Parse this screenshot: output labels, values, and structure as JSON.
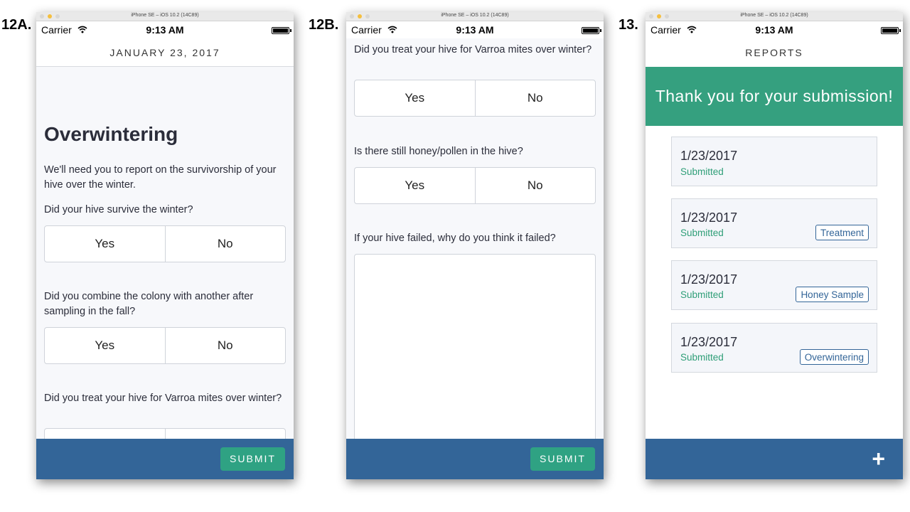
{
  "figure_labels": [
    "12A.",
    "12B.",
    "13."
  ],
  "simulator": {
    "title": "iPhone SE – iOS 10.2 (14C89)"
  },
  "status_bar": {
    "carrier": "Carrier",
    "time": "9:13 AM"
  },
  "screen_a": {
    "nav_title": "JANUARY 23, 2017",
    "heading": "Overwintering",
    "intro": "We'll need you to report on the survivorship of your hive over the winter.",
    "questions": [
      "Did your hive survive the winter?",
      "Did you combine the colony with another after sampling in the fall?",
      "Did you treat your hive for Varroa mites over winter?"
    ],
    "yes_label": "Yes",
    "no_label": "No",
    "submit_label": "SUBMIT"
  },
  "screen_b": {
    "questions": [
      "Did you treat your hive for Varroa mites over winter?",
      "Is there still honey/pollen in the hive?",
      "If your hive failed, why do you think it failed?"
    ],
    "yes_label": "Yes",
    "no_label": "No",
    "submit_label": "SUBMIT"
  },
  "screen_c": {
    "nav_title": "REPORTS",
    "banner": "Thank you for your submission!",
    "reports": [
      {
        "date": "1/23/2017",
        "status": "Submitted",
        "tag": ""
      },
      {
        "date": "1/23/2017",
        "status": "Submitted",
        "tag": "Treatment"
      },
      {
        "date": "1/23/2017",
        "status": "Submitted",
        "tag": "Honey Sample"
      },
      {
        "date": "1/23/2017",
        "status": "Submitted",
        "tag": "Overwintering"
      }
    ],
    "add_label": "+"
  },
  "colors": {
    "bottom_bar": "#336598",
    "submit": "#2fa283",
    "banner": "#35a07f",
    "submitted_text": "#2e9e77"
  }
}
